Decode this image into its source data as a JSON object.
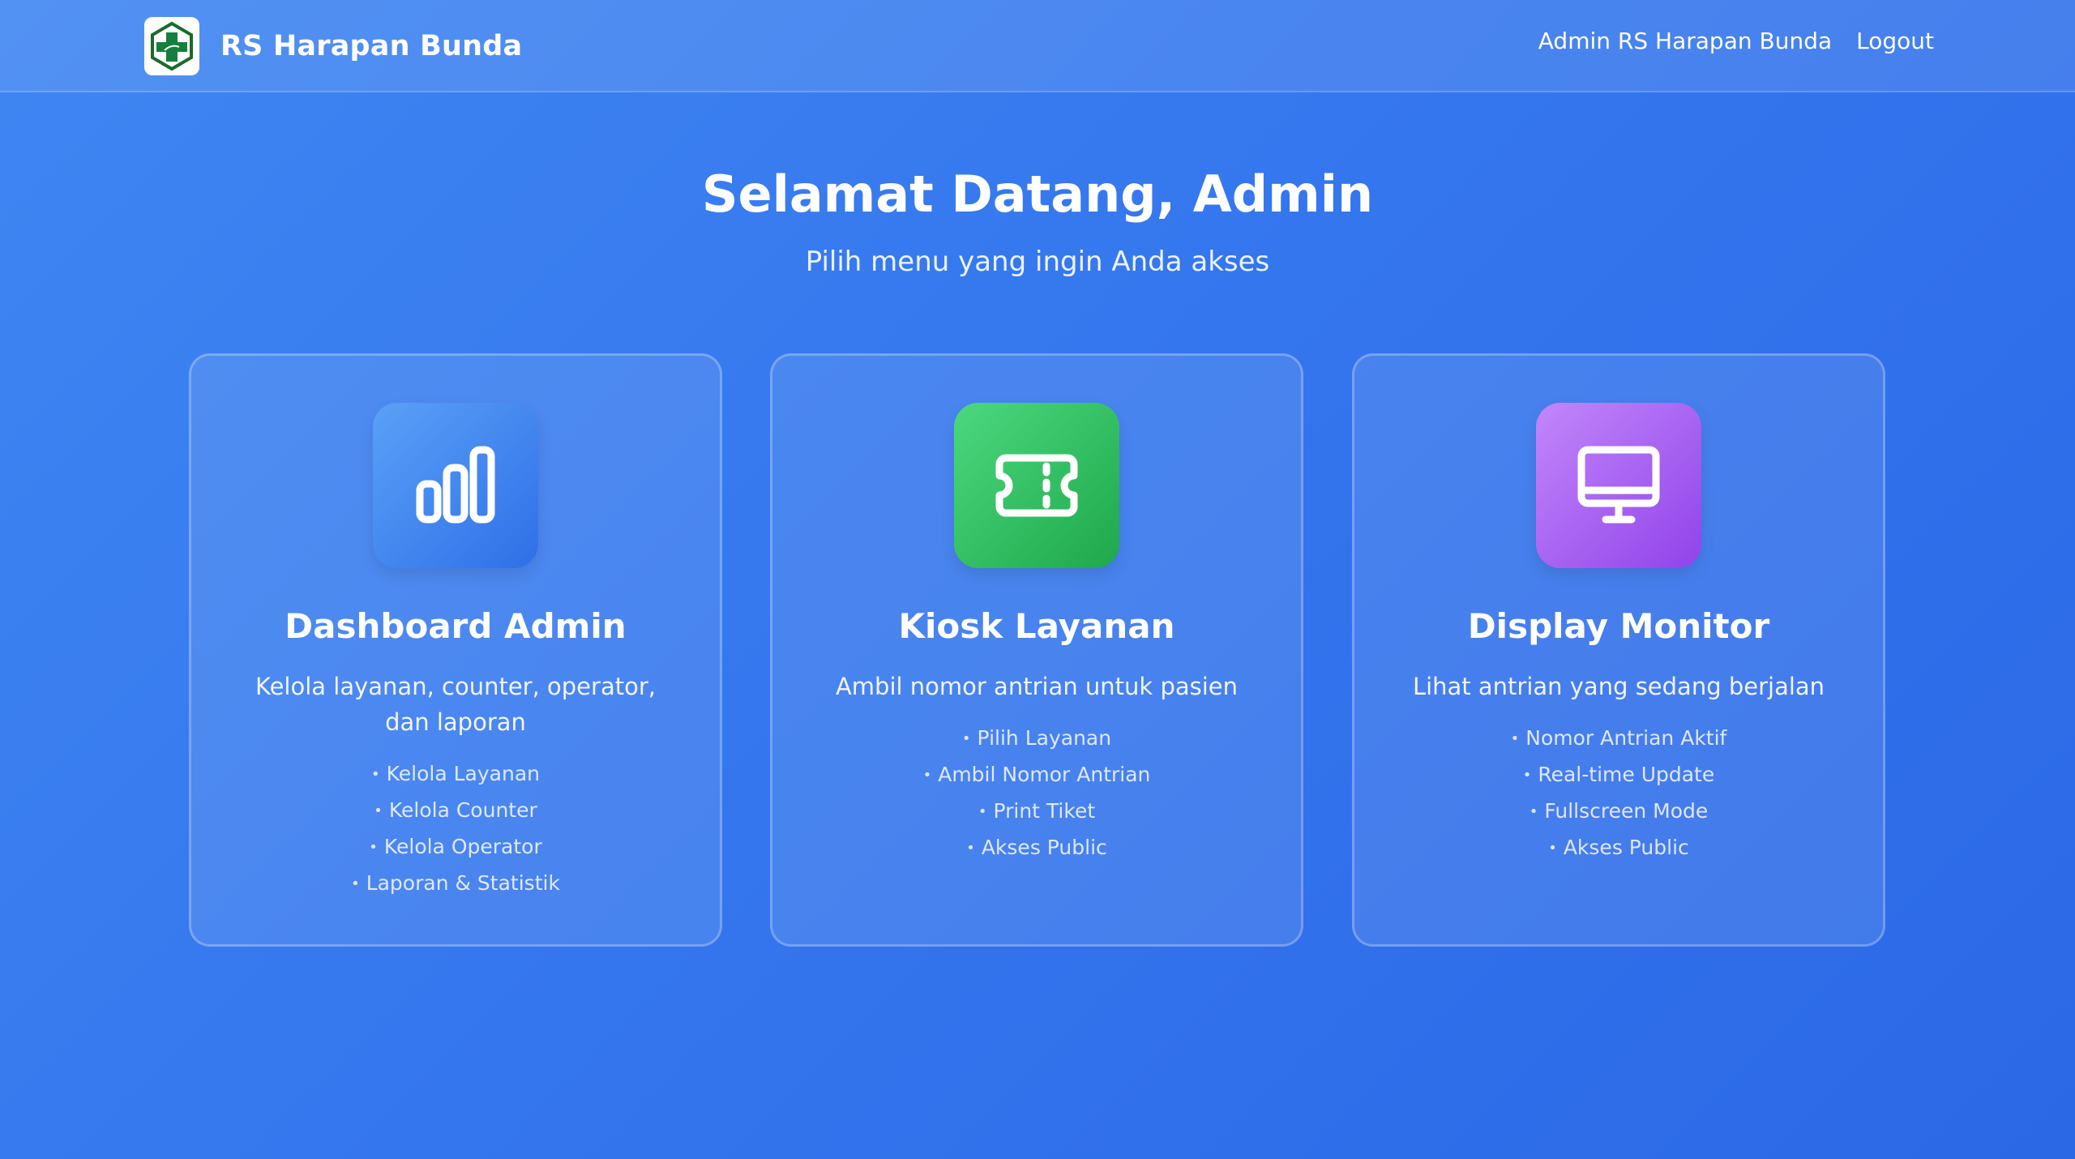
{
  "app": {
    "name": "RS Harapan Bunda",
    "logo_icon": "hospital-cross-logo"
  },
  "nav": {
    "user_label": "Admin RS Harapan Bunda",
    "logout_label": "Logout"
  },
  "hero": {
    "title": "Selamat Datang, Admin",
    "subtitle": "Pilih menu yang ingin Anda akses"
  },
  "cards": [
    {
      "title": "Dashboard Admin",
      "icon": "bar-chart-icon",
      "color": "#3b82f6",
      "description": "Kelola layanan, counter, operator, dan laporan",
      "features": [
        "Kelola Layanan",
        "Kelola Counter",
        "Kelola Operator",
        "Laporan & Statistik"
      ]
    },
    {
      "title": "Kiosk Layanan",
      "icon": "ticket-icon",
      "color": "#22c55e",
      "description": "Ambil nomor antrian untuk pasien",
      "features": [
        "Pilih Layanan",
        "Ambil Nomor Antrian",
        "Print Tiket",
        "Akses Public"
      ]
    },
    {
      "title": "Display Monitor",
      "icon": "monitor-icon",
      "color": "#a855f7",
      "description": "Lihat antrian yang sedang berjalan",
      "features": [
        "Nomor Antrian Aktif",
        "Real-time Update",
        "Fullscreen Mode",
        "Akses Public"
      ]
    }
  ],
  "bullet": "•"
}
